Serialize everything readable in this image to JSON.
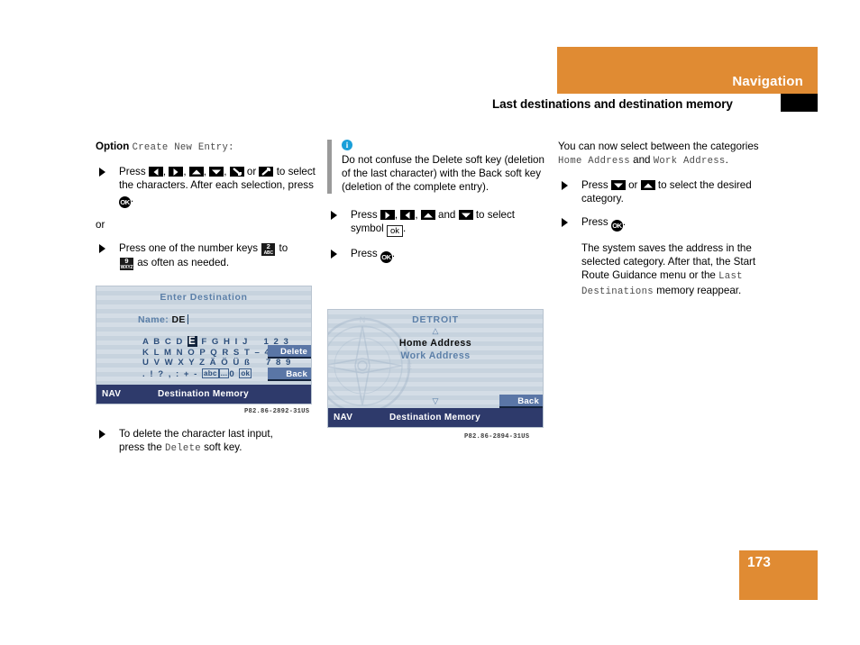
{
  "header": {
    "title": "Navigation",
    "subtitle": "Last destinations and destination memory"
  },
  "page_number": "173",
  "col1": {
    "option_label": "Option",
    "option_value": "Create New Entry:",
    "b1_press": "Press",
    "b1_keys": [
      {
        "icon": "arrow-left-key",
        "glyph": "◀"
      },
      {
        "icon": "arrow-right-key",
        "glyph": "▶"
      },
      {
        "icon": "arrow-up-key",
        "glyph": "▲"
      },
      {
        "icon": "arrow-down-key",
        "glyph": "▼"
      },
      {
        "icon": "diagonal-down-key",
        "glyph": "↘"
      },
      {
        "icon": "diagonal-up-key",
        "glyph": "↗"
      }
    ],
    "b1_or": "or",
    "b1_tail": "to select the characters. After each selection, press",
    "ok_label": "OK",
    "period": ".",
    "or_text": "or",
    "b2_pre": "Press one of the number keys",
    "b2_key_from": {
      "num": "2",
      "letters": "ABC"
    },
    "b2_mid": "to",
    "b2_key_to": {
      "num": "9",
      "letters": "WXYZ"
    },
    "b2_tail": "as often as needed.",
    "b3_line1": "To delete the character last input,",
    "b3_pre": "press the",
    "b3_softkey": "Delete",
    "b3_tail": "soft key."
  },
  "figure1": {
    "title": "Enter Destination",
    "name_label": "Name:",
    "name_value": "DE",
    "char_rows": [
      {
        "text": "A B C D ",
        "highlight": "E",
        "rest": " F G H I J    1 2 3"
      },
      {
        "text": "K L M N O P Q R S T – 4 5 6"
      },
      {
        "text": "U V W X Y Z Ä Ö Ü ß    7 8 9"
      }
    ],
    "char_row4": {
      "prefix": ". ! ? , : + -",
      "box1": "abc",
      "box2": "...",
      "zero": "0",
      "box3": "ok"
    },
    "softkey_delete": "Delete",
    "softkey_back": "Back",
    "navbar_left": "NAV",
    "navbar_title": "Destination Memory",
    "caption": "P82.86-2892-31US"
  },
  "col2": {
    "note_icon": "info-icon",
    "note_glyph": "i",
    "note_text": "Do not confuse the Delete soft key (deletion of the last character) with the Back soft key (deletion of the complete entry).",
    "b1_press": "Press",
    "b1_keys": [
      {
        "icon": "arrow-right-key",
        "glyph": "▶"
      },
      {
        "icon": "arrow-left-key",
        "glyph": "◀"
      },
      {
        "icon": "arrow-up-key",
        "glyph": "▲"
      },
      {
        "icon": "arrow-down-key",
        "glyph": "▼"
      }
    ],
    "b1_and": "and",
    "b1_tail": "to select symbol",
    "b1_symbol": "ok",
    "b1_period": ".",
    "b2_press": "Press",
    "ok_label": "OK",
    "b2_period": "."
  },
  "figure2": {
    "title": "DETROIT",
    "up_arrow": "△",
    "down_arrow": "▽",
    "option_home": "Home Address",
    "option_work": "Work Address",
    "softkey_back": "Back",
    "navbar_left": "NAV",
    "navbar_title": "Destination Memory",
    "caption": "P82.86-2894-31US"
  },
  "col3": {
    "p1_a": "You can now select between the categories",
    "p1_b": "Home Address",
    "p1_c": "and",
    "p1_d": "Work Address",
    "p1_e": ".",
    "b1_press": "Press",
    "b1_keys": [
      {
        "icon": "arrow-down-key",
        "glyph": "▼"
      },
      {
        "icon": "arrow-up-key",
        "glyph": "▲"
      }
    ],
    "b1_or": "or",
    "b1_tail": "to select the desired category.",
    "b2_press": "Press",
    "ok_label": "OK",
    "b2_period": ".",
    "p2_a": "The system saves the address in the selected category. After that, the Start Route Guidance menu or the",
    "p2_b": "Last Destinations",
    "p2_c": "memory reappear."
  },
  "colors": {
    "accent_orange": "#e08b33",
    "note_blue": "#1a9fd9",
    "screen_blue": "#2d4f7c",
    "navbar_blue": "#2e3a6b",
    "softkey_blue": "#5a76a6"
  }
}
